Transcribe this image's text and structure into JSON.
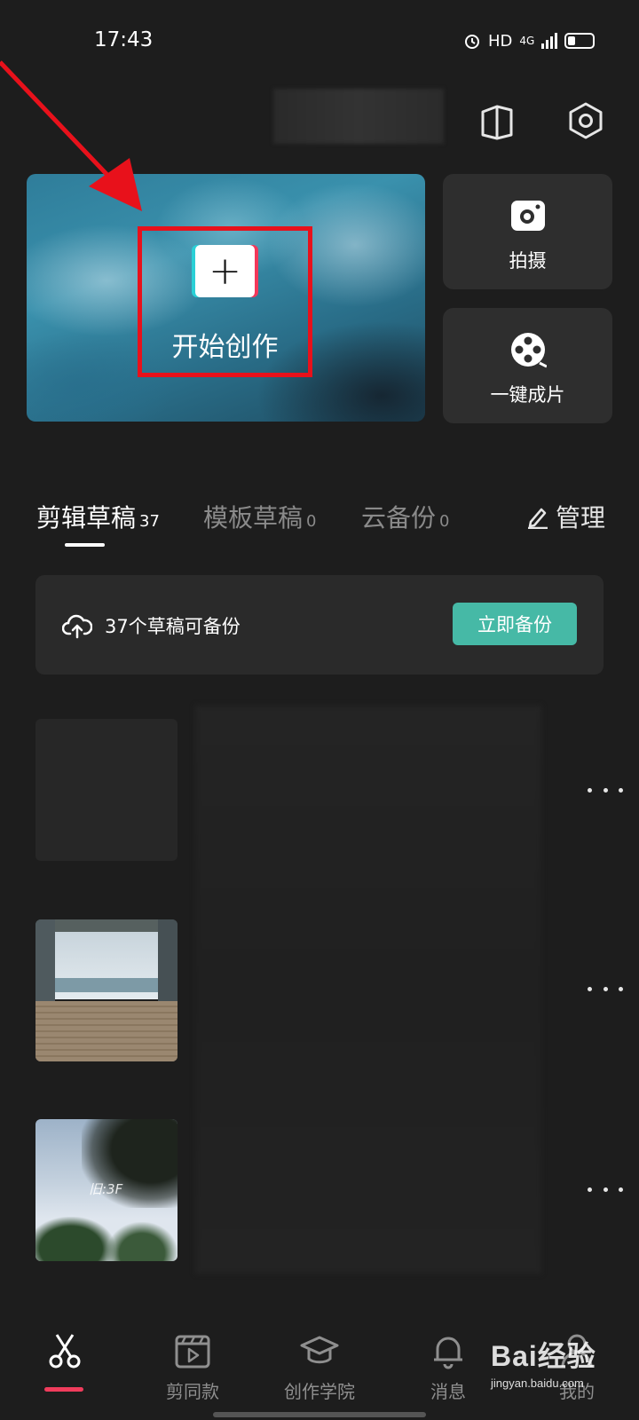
{
  "status_bar": {
    "time": "17:43",
    "hd": "HD",
    "network": "4G"
  },
  "quick_actions": {
    "create_label": "开始创作",
    "shoot_label": "拍摄",
    "one_click_label": "一键成片"
  },
  "tabs": [
    {
      "label": "剪辑草稿",
      "count": "37"
    },
    {
      "label": "模板草稿",
      "count": "0"
    },
    {
      "label": "云备份",
      "count": "0"
    }
  ],
  "manage_label": "管理",
  "backup": {
    "text": "37个草稿可备份",
    "button_label": "立即备份"
  },
  "drafts": {
    "thumb_3_overlay": "旧:3F"
  },
  "bottom_nav": [
    {
      "label": ""
    },
    {
      "label": "剪同款"
    },
    {
      "label": "创作学院"
    },
    {
      "label": "消息"
    },
    {
      "label": "我的"
    }
  ],
  "watermark": {
    "brand": "Bai经验",
    "url": "jingyan.baidu.com"
  },
  "colors": {
    "background": "#1d1d1d",
    "accent_teal": "#46b9a6",
    "highlight_red": "#e8111b",
    "active_pink": "#f03c5c"
  }
}
